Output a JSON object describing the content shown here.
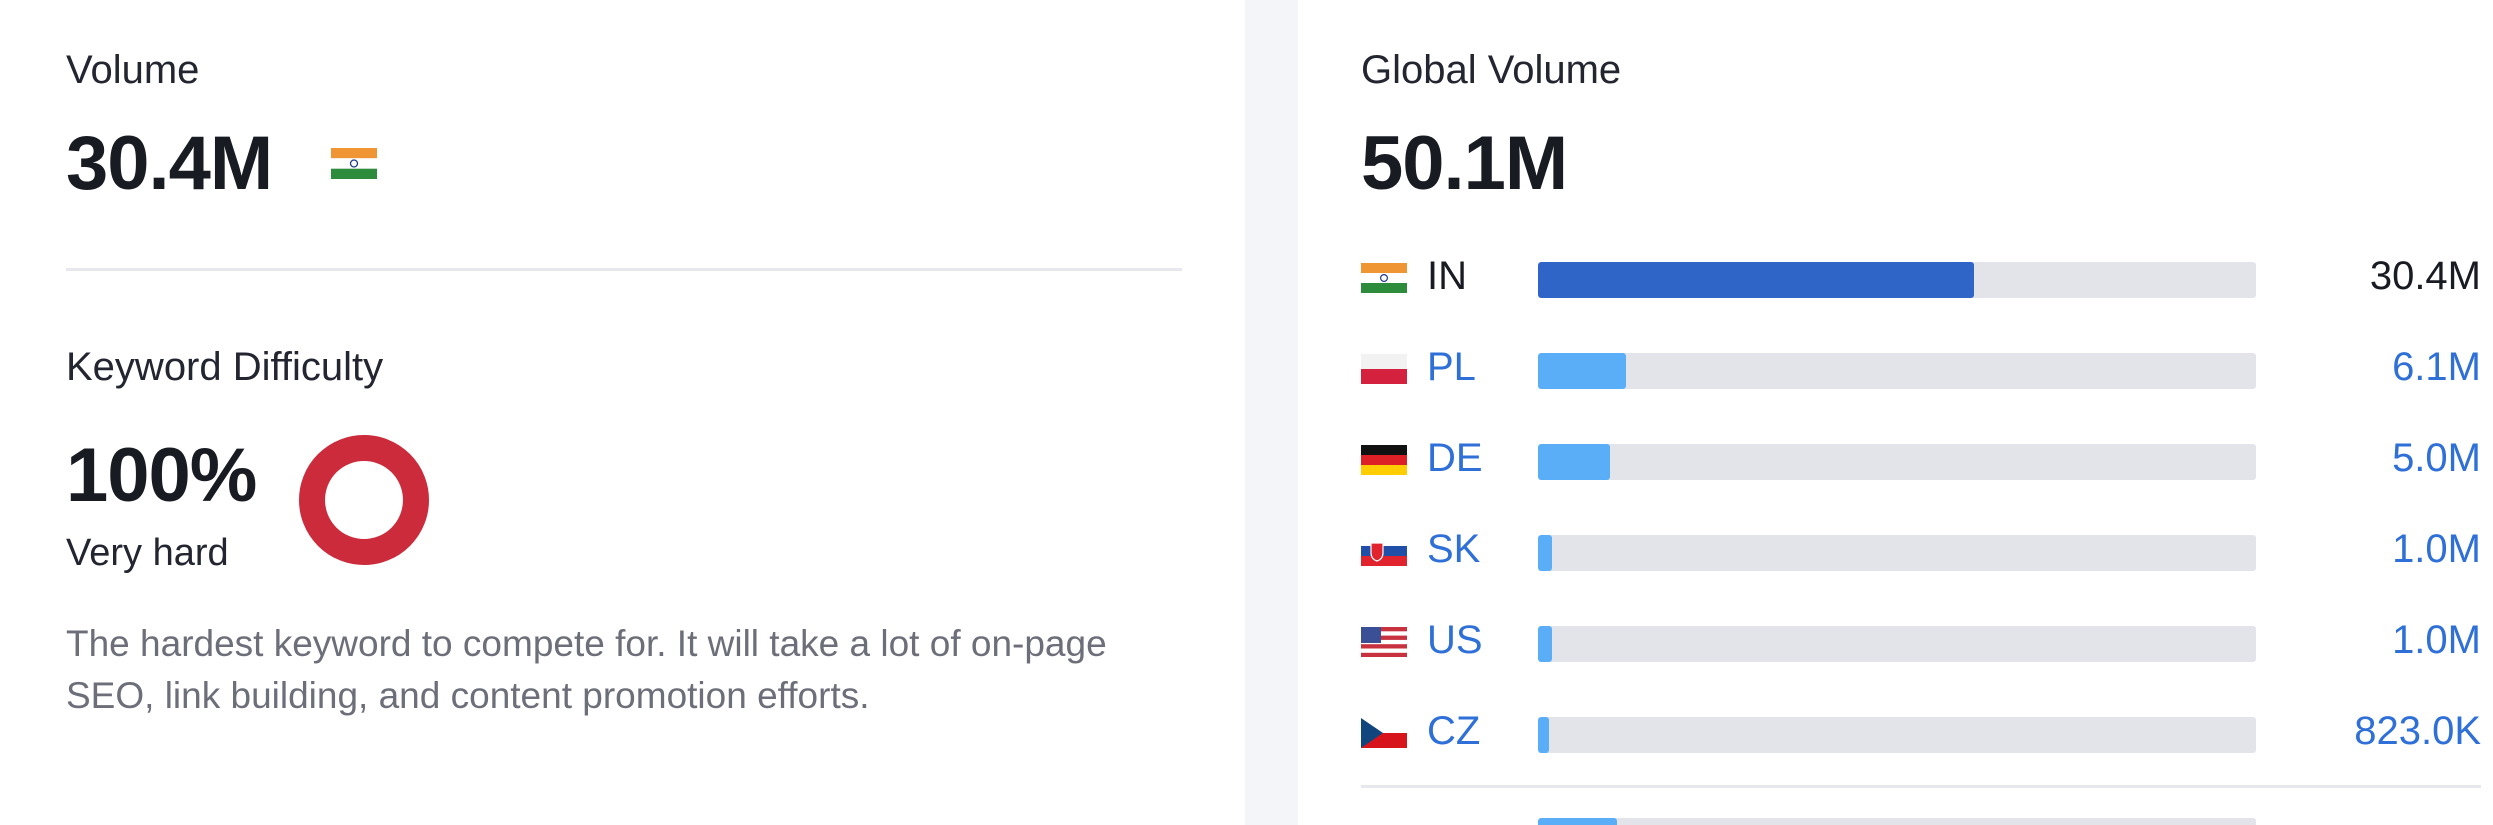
{
  "volume": {
    "label": "Volume",
    "value": "30.4M",
    "flag_icon": "india-flag-icon"
  },
  "keyword_difficulty": {
    "label": "Keyword Difficulty",
    "value": "100%",
    "level": "Very hard",
    "percent": 100,
    "color": "#cc2b3b",
    "description": "The hardest keyword to compete for. It will take a lot of on-page SEO, link building, and content promotion efforts."
  },
  "global_volume": {
    "label": "Global Volume",
    "value": "50.1M",
    "countries": [
      {
        "code": "IN",
        "value": "30.4M",
        "share": 0.607,
        "flag_icon": "india-flag-icon",
        "bar_color": "#2f65c7",
        "link": false
      },
      {
        "code": "PL",
        "value": "6.1M",
        "share": 0.122,
        "flag_icon": "poland-flag-icon",
        "bar_color": "#5aaef7",
        "link": true
      },
      {
        "code": "DE",
        "value": "5.0M",
        "share": 0.1,
        "flag_icon": "germany-flag-icon",
        "bar_color": "#5aaef7",
        "link": true
      },
      {
        "code": "SK",
        "value": "1.0M",
        "share": 0.02,
        "flag_icon": "slovakia-flag-icon",
        "bar_color": "#5aaef7",
        "link": true
      },
      {
        "code": "US",
        "value": "1.0M",
        "share": 0.02,
        "flag_icon": "us-flag-icon",
        "bar_color": "#5aaef7",
        "link": true
      },
      {
        "code": "CZ",
        "value": "823.0K",
        "share": 0.016,
        "flag_icon": "czech-flag-icon",
        "bar_color": "#5aaef7",
        "link": true
      }
    ],
    "others": {
      "share": 0.11,
      "bar_color": "#5aaef7"
    }
  }
}
